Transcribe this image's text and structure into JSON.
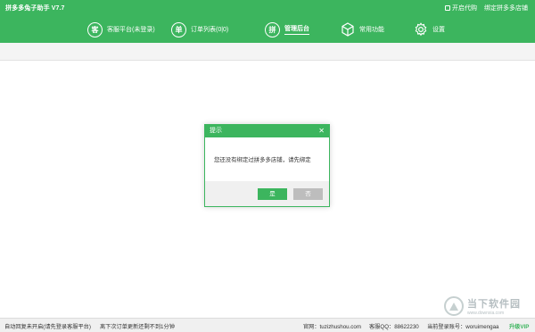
{
  "app": {
    "title": "拼多多兔子助手 V7.7"
  },
  "top_links": [
    {
      "label": "开启代购"
    },
    {
      "label": "绑定拼多多店铺"
    }
  ],
  "nav": [
    {
      "icon_char": "客",
      "label": "客服平台(未登录)",
      "icon": "service-icon"
    },
    {
      "icon_char": "单",
      "label": "订单列表(0|0)",
      "icon": "order-icon"
    },
    {
      "icon_char": "拼",
      "label": "管理后台",
      "icon": "admin-icon",
      "active": true
    },
    {
      "icon_char": "",
      "label": "常用功能",
      "icon": "cube-icon"
    },
    {
      "icon_char": "",
      "label": "设置",
      "icon": "gear-icon"
    }
  ],
  "dialog": {
    "title": "提示",
    "close": "✕",
    "message": "您还没有绑定过拼多多店铺，请先绑定",
    "yes_label": "是",
    "no_label": "否"
  },
  "status": {
    "left1": "自动回复未开启(请先登录客服平台)",
    "left2": "离下次订单更新还剩不到1分钟",
    "site": "官网：tuzizhushou.com",
    "qq": "客服QQ：88622230",
    "account": "当前登录账号：woruimengaa",
    "vip": "升级VIP"
  },
  "watermark": {
    "cn": "当下软件园",
    "en": "www.downxia.com"
  },
  "colors": {
    "brand": "#3cb55e",
    "disabled": "#bdbdbd"
  }
}
